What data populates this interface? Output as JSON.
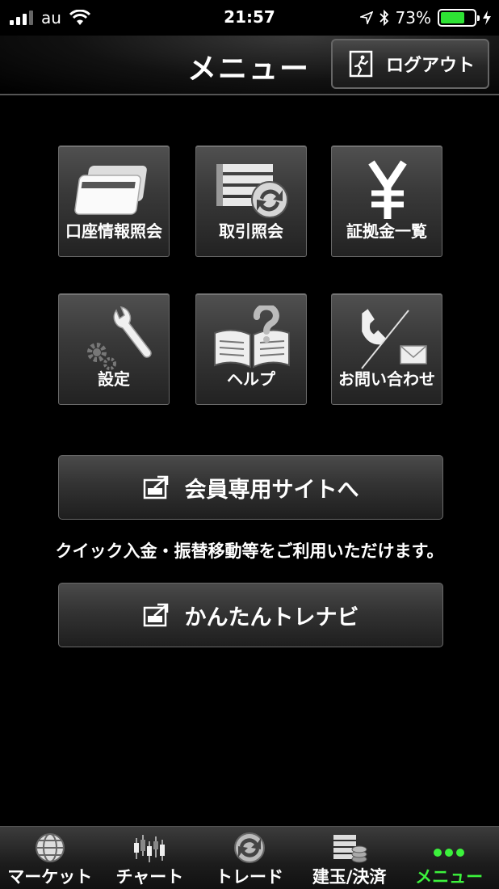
{
  "status": {
    "carrier": "au",
    "time": "21:57",
    "battery": "73%",
    "battery_level": 0.73
  },
  "header": {
    "title": "メニュー",
    "logout_label": "ログアウト"
  },
  "grid": {
    "items": [
      {
        "label": "口座情報照会",
        "icon": "card-icon"
      },
      {
        "label": "取引照会",
        "icon": "trade-list-icon"
      },
      {
        "label": "証拠金一覧",
        "icon": "yen-icon"
      },
      {
        "label": "設定",
        "icon": "wrench-gear-icon"
      },
      {
        "label": "ヘルプ",
        "icon": "help-book-icon"
      },
      {
        "label": "お問い合わせ",
        "icon": "phone-mail-icon"
      }
    ]
  },
  "member_site": {
    "label": "会員専用サイトへ",
    "notice": "クイック入金・振替移動等をご利用いただけます。"
  },
  "navi": {
    "label": "かんたんトレナビ"
  },
  "tabbar": {
    "items": [
      {
        "label": "マーケット",
        "icon": "globe-icon"
      },
      {
        "label": "チャート",
        "icon": "candlestick-icon"
      },
      {
        "label": "トレード",
        "icon": "trade-icon"
      },
      {
        "label": "建玉/決済",
        "icon": "position-icon"
      },
      {
        "label": "メニュー",
        "icon": "more-dots-icon",
        "active": true
      }
    ],
    "active_color": "#3cf23c"
  }
}
